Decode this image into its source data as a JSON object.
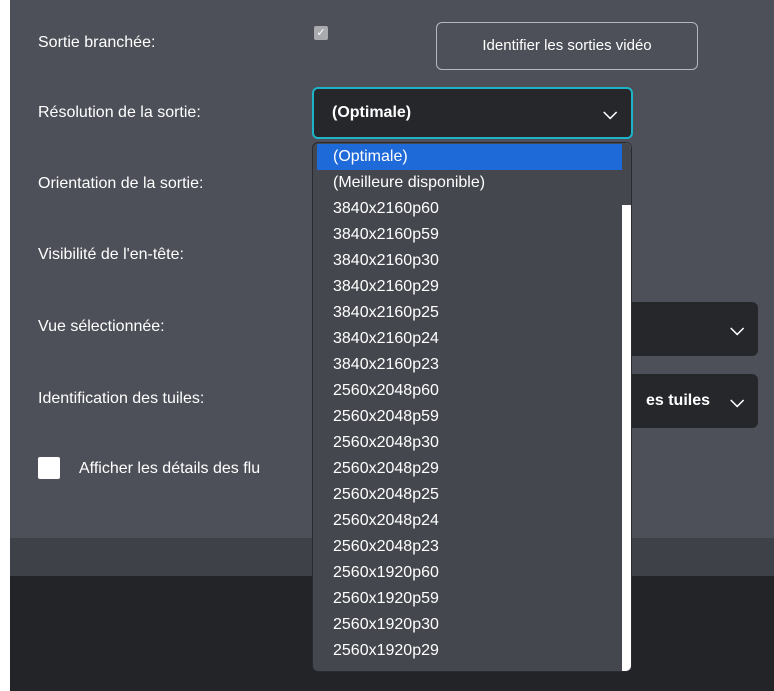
{
  "labels": {
    "output_connected": "Sortie branchée:",
    "output_resolution": "Résolution de la sortie:",
    "output_orientation": "Orientation de la sortie:",
    "header_visibility": "Visibilité de l'en-tête:",
    "selected_view": "Vue sélectionnée:",
    "tile_identification": "Identification des tuiles:"
  },
  "identify_button": "Identifier les sorties vidéo",
  "resolution_select": {
    "value": "(Optimale)"
  },
  "tiles_select": {
    "value_visible": "es tuiles"
  },
  "details_checkbox": {
    "label": "Afficher les détails des flu",
    "checked": false
  },
  "resolution_options": [
    "(Optimale)",
    "(Meilleure disponible)",
    "3840x2160p60",
    "3840x2160p59",
    "3840x2160p30",
    "3840x2160p29",
    "3840x2160p25",
    "3840x2160p24",
    "3840x2160p23",
    "2560x2048p60",
    "2560x2048p59",
    "2560x2048p30",
    "2560x2048p29",
    "2560x2048p25",
    "2560x2048p24",
    "2560x2048p23",
    "2560x1920p60",
    "2560x1920p59",
    "2560x1920p30",
    "2560x1920p29"
  ],
  "selected_option_index": 0,
  "colors": {
    "panel_bg": "#4d5058",
    "select_bg": "#25272b",
    "focus_border": "#1fb3c7",
    "selected_option": "#1f6ad9",
    "dropdown_bg": "#45474e",
    "bottom_bg": "#232428"
  }
}
